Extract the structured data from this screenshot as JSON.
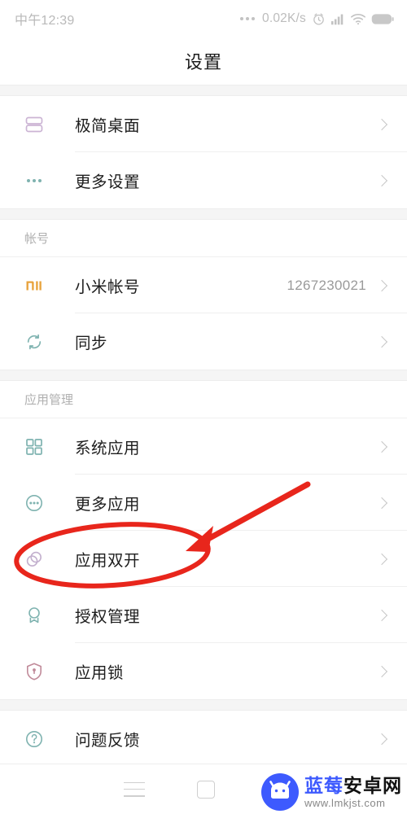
{
  "status_bar": {
    "time": "中午12:39",
    "network_speed": "0.02K/s",
    "icons": [
      "more-dots-icon",
      "alarm-icon",
      "signal-icon",
      "wifi-icon",
      "battery-icon"
    ]
  },
  "header": {
    "title": "设置"
  },
  "list": [
    {
      "type": "group",
      "rows": [
        {
          "icon": "minimalist-desktop-icon",
          "label": "极简桌面",
          "value": "",
          "chevron": true
        },
        {
          "icon": "more-settings-dots-icon",
          "label": "更多设置",
          "value": "",
          "chevron": true
        }
      ]
    },
    {
      "type": "group",
      "section": "帐号",
      "rows": [
        {
          "icon": "mi-logo-icon",
          "label": "小米帐号",
          "value": "1267230021",
          "chevron": true
        },
        {
          "icon": "sync-icon",
          "label": "同步",
          "value": "",
          "chevron": true
        }
      ]
    },
    {
      "type": "group",
      "section": "应用管理",
      "rows": [
        {
          "icon": "grid-apps-icon",
          "label": "系统应用",
          "value": "",
          "chevron": true
        },
        {
          "icon": "more-apps-circle-dots-icon",
          "label": "更多应用",
          "value": "",
          "chevron": true
        },
        {
          "icon": "dual-apps-circles-icon",
          "label": "应用双开",
          "value": "",
          "chevron": true,
          "highlighted": true
        },
        {
          "icon": "authorization-badge-icon",
          "label": "授权管理",
          "value": "",
          "chevron": true
        },
        {
          "icon": "app-lock-shield-icon",
          "label": "应用锁",
          "value": "",
          "chevron": true
        }
      ]
    },
    {
      "type": "group",
      "rows": [
        {
          "icon": "feedback-question-icon",
          "label": "问题反馈",
          "value": "",
          "chevron": true
        }
      ]
    }
  ],
  "nav_bar": {
    "menu_label": "menu-button",
    "home_label": "home-button"
  },
  "watermark": {
    "title_blue": "蓝莓",
    "title_black": "安卓网",
    "url": "www.lmkjst.com"
  },
  "annotation": {
    "color": "#e8261c",
    "shape": "ellipse-with-arrow",
    "target": "应用双开"
  },
  "colors": {
    "accent_pink": "#cbb4d4",
    "accent_teal": "#7fb3b0",
    "accent_orange": "#e8a33d",
    "accent_mauve": "#c08a99",
    "annotation_red": "#e8261c",
    "watermark_blue": "#3d5afe"
  }
}
